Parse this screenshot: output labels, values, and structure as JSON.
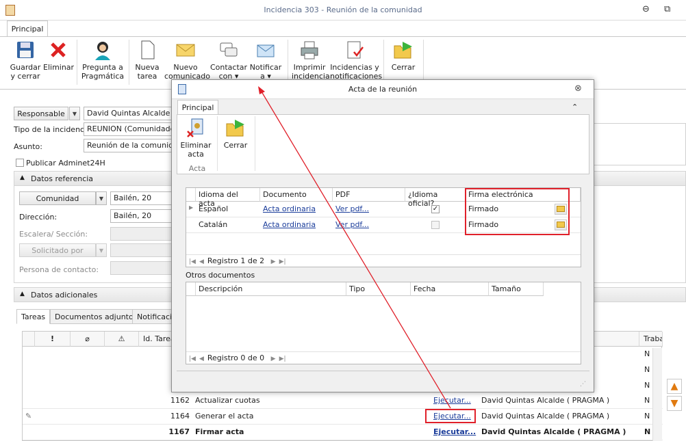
{
  "window": {
    "title": "Incidencia 303 - Reunión de la comunidad",
    "minimize": "⊖",
    "restore": "⧉"
  },
  "ribbon": {
    "tab": "Principal",
    "buttons": [
      {
        "label": "Guardar y cerrar",
        "icon": "save-icon"
      },
      {
        "label": "Eliminar",
        "icon": "delete-icon"
      },
      {
        "label": "Pregunta a Pragmática",
        "icon": "assistant-icon"
      },
      {
        "label": "Nueva tarea",
        "icon": "new-document-icon"
      },
      {
        "label": "Nuevo comunicado",
        "icon": "envelope-icon"
      },
      {
        "label": "Contactar con ▾",
        "icon": "chat-icon"
      },
      {
        "label": "Notificar a ▾",
        "icon": "notify-envelope-icon"
      },
      {
        "label": "Imprimir incidencia",
        "icon": "printer-icon"
      },
      {
        "label": "Incidencias y notificaciones",
        "icon": "checklist-icon"
      },
      {
        "label": "Cerrar",
        "icon": "exit-folder-icon"
      }
    ]
  },
  "form": {
    "responsable_btn": "Responsable",
    "responsable_value": "David Quintas Alcalde ( PRAGMA )",
    "tipo_label": "Tipo de la incidencia:",
    "tipo_value": "REUNION (Comunidades)",
    "asunto_label": "Asunto:",
    "asunto_value": "Reunión de la comunidad",
    "publicar_label": "Publicar Adminet24H",
    "datos_ref": "Datos referencia",
    "comunidad_btn": "Comunidad",
    "comunidad_value": "Bailén, 20",
    "direccion_label": "Dirección:",
    "direccion_value": "Bailén, 20",
    "escalera_label": "Escalera/ Sección:",
    "solicitado_btn": "Solicitado por",
    "contacto_label": "Persona de contacto:",
    "datos_adic": "Datos adicionales",
    "tabs": [
      "Tareas",
      "Documentos adjuntos",
      "Notificaciones"
    ]
  },
  "tasks": {
    "headers": [
      "!",
      "Id. Tarea",
      "Trabajo"
    ],
    "rows": [
      {
        "id": "1162",
        "title": "Actualizar cuotas",
        "action": "Ejecutar...",
        "user": "David Quintas Alcalde ( PRAGMA )",
        "flag": "N"
      },
      {
        "id": "1164",
        "title": "Generar el acta",
        "action": "Ejecutar...",
        "user": "David Quintas Alcalde ( PRAGMA )",
        "flag": "N"
      },
      {
        "id": "1167",
        "title": "Firmar acta",
        "action": "Ejecutar...",
        "user": "David Quintas Alcalde ( PRAGMA )",
        "flag": "N"
      }
    ],
    "partial_flags": [
      "N",
      "N",
      "N"
    ]
  },
  "modal": {
    "title": "Acta de la reunión",
    "close": "⊗",
    "tab": "Principal",
    "collapse": "⌃",
    "buttons": [
      {
        "label": "Eliminar acta"
      },
      {
        "label": "Cerrar"
      }
    ],
    "group": "Acta",
    "acta_headers": [
      "Idioma del acta",
      "Documento",
      "PDF",
      "¿Idioma oficial?",
      "Firma electrónica"
    ],
    "acta_rows": [
      {
        "idioma": "Español",
        "documento": "Acta ordinaria",
        "pdf": "Ver pdf...",
        "oficial": "✓",
        "firma": "Firmado"
      },
      {
        "idioma": "Catalán",
        "documento": "Acta ordinaria",
        "pdf": "Ver pdf...",
        "oficial": "",
        "firma": "Firmado"
      }
    ],
    "acta_nav": "Registro 1 de 2",
    "otros_label": "Otros documentos",
    "otros_headers": [
      "Descripción",
      "Tipo",
      "Fecha",
      "Tamaño"
    ],
    "otros_nav": "Registro 0 de 0"
  },
  "colors": {
    "accent_red": "#e0202a",
    "link": "#1a3c9a",
    "title_text": "#5a6b8a"
  }
}
